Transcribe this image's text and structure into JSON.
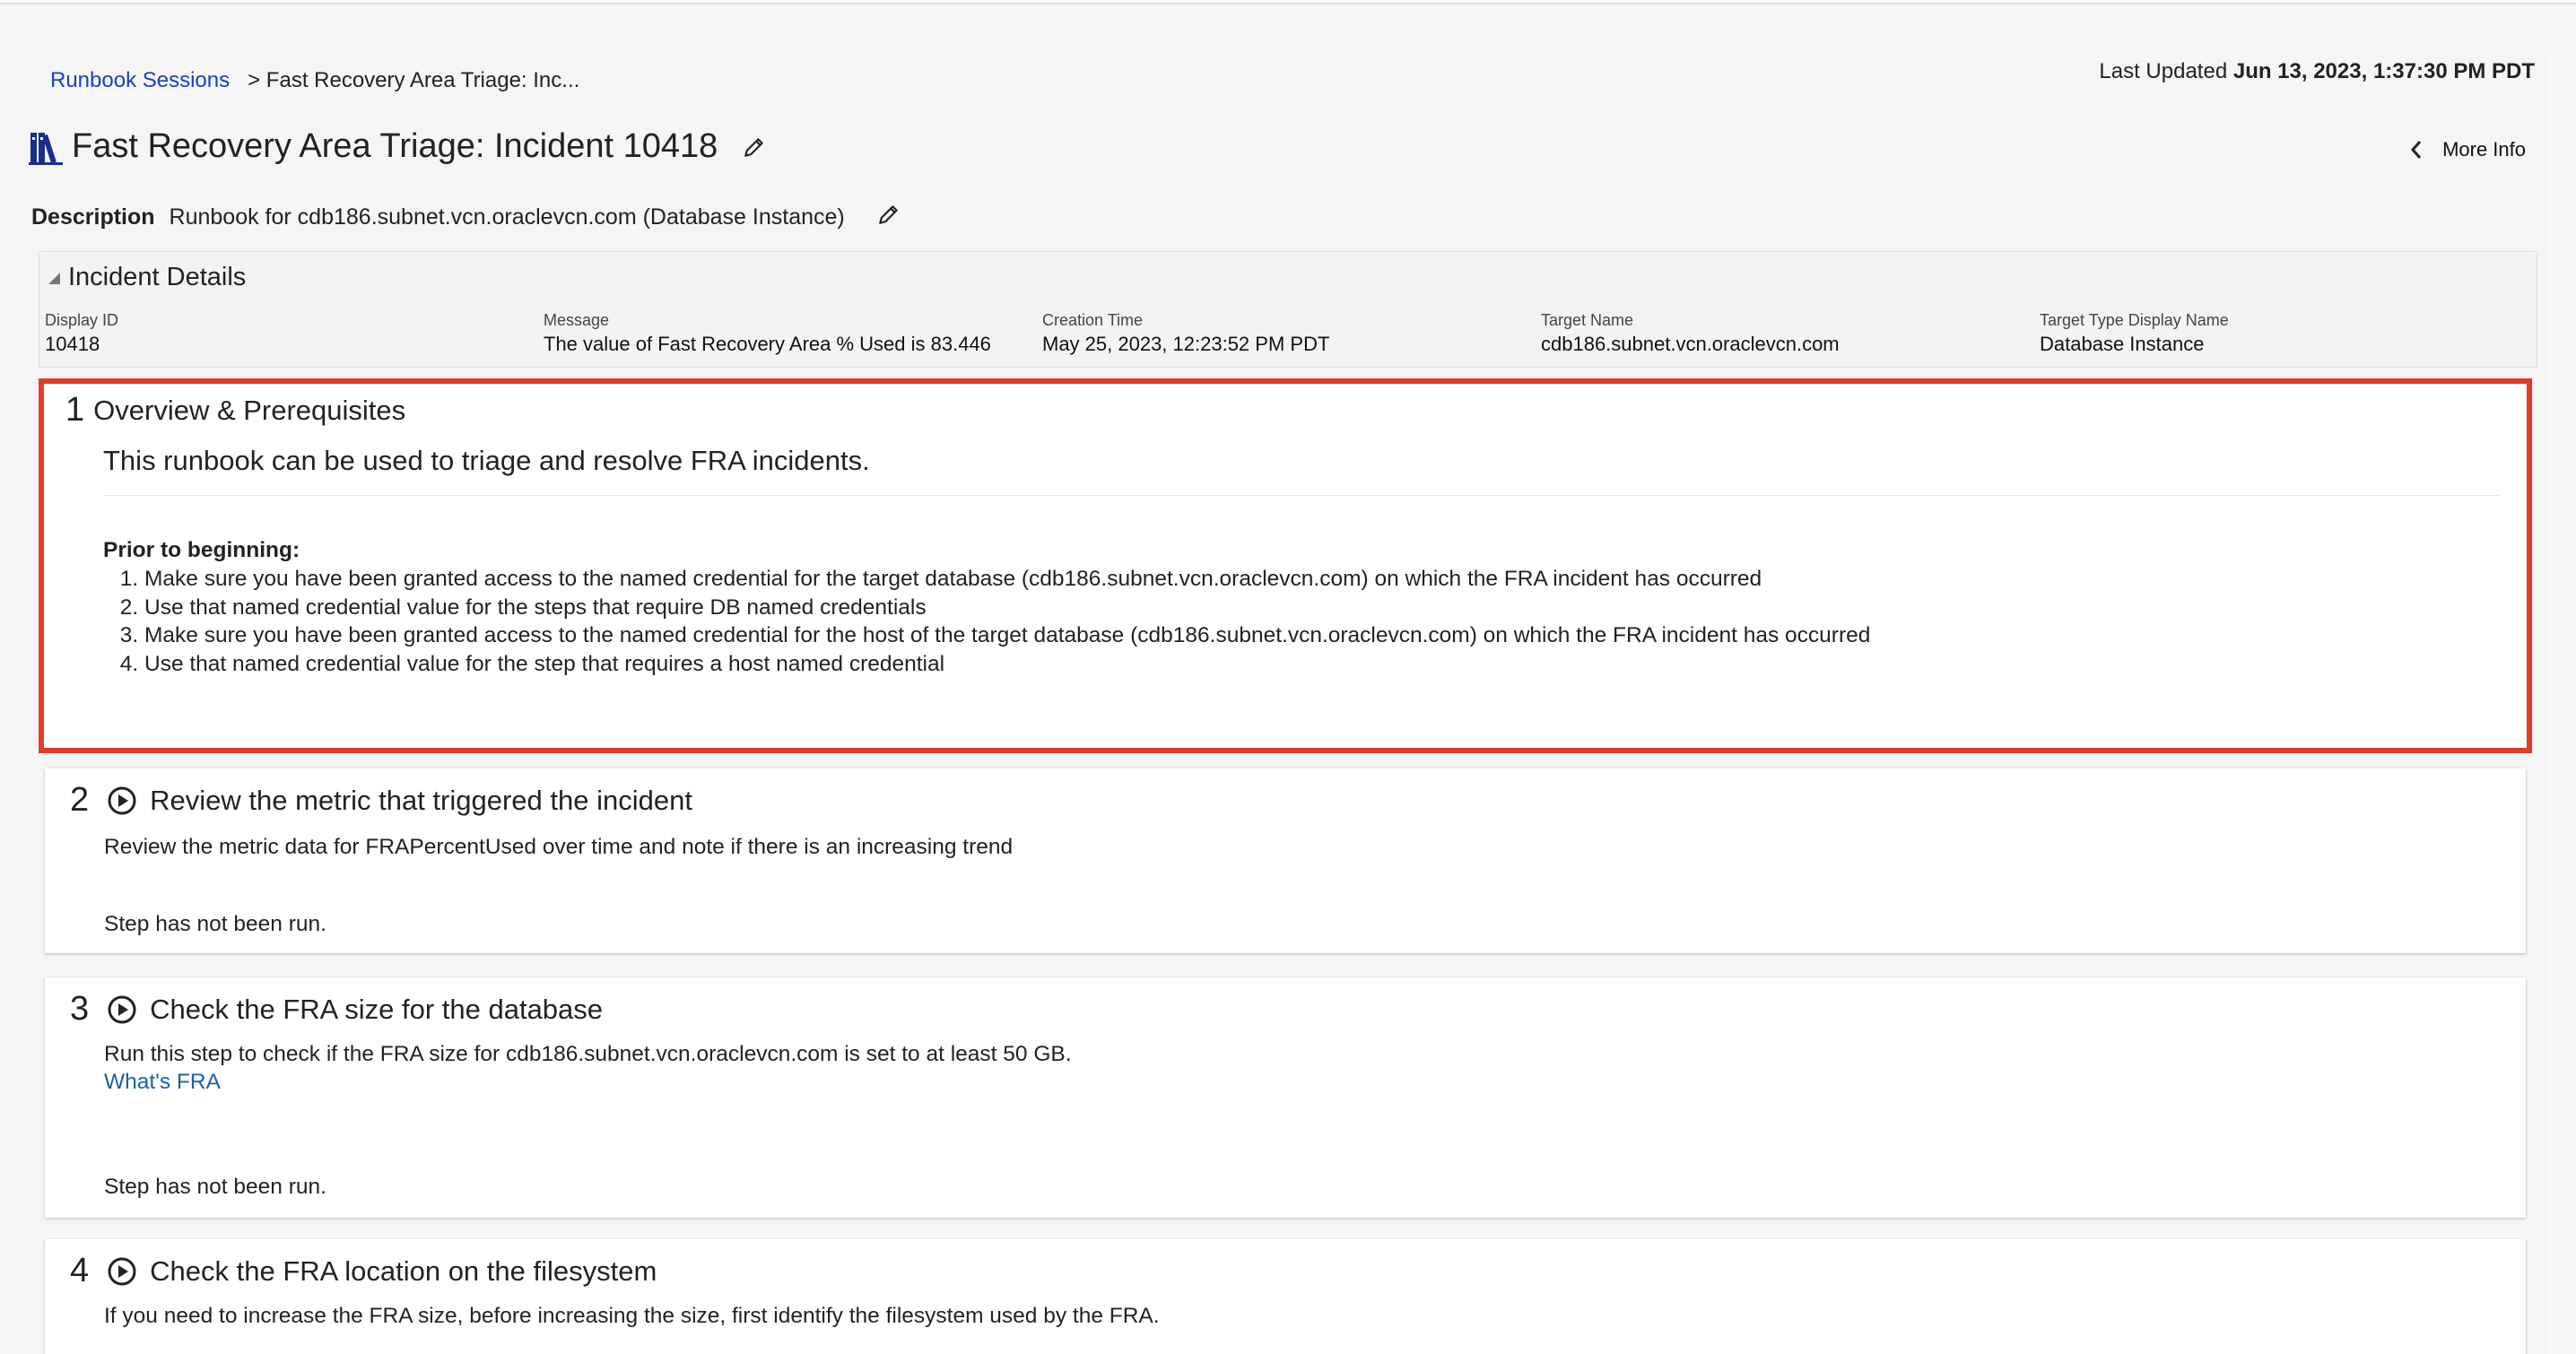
{
  "breadcrumb": {
    "root": "Runbook Sessions",
    "current": "> Fast Recovery Area Triage: Inc..."
  },
  "last_updated": {
    "label": "Last Updated",
    "value": "Jun 13, 2023, 1:37:30 PM PDT"
  },
  "page_title": "Fast Recovery Area Triage: Incident 10418",
  "more_info": "More Info",
  "description": {
    "label": "Description",
    "value": "Runbook for cdb186.subnet.vcn.oraclevcn.com (Database Instance)"
  },
  "incident": {
    "heading": "Incident Details",
    "fields": [
      {
        "label": "Display ID",
        "value": "10418"
      },
      {
        "label": "Message",
        "value": "The value of Fast Recovery Area % Used is 83.446"
      },
      {
        "label": "Creation Time",
        "value": "May 25, 2023, 12:23:52 PM PDT"
      },
      {
        "label": "Target Name",
        "value": "cdb186.subnet.vcn.oraclevcn.com"
      },
      {
        "label": "Target Type Display Name",
        "value": "Database Instance"
      }
    ]
  },
  "steps": [
    {
      "number": "1",
      "title": "Overview & Prerequisites",
      "lead": "This runbook can be used to triage and resolve FRA incidents.",
      "prior_label": "Prior to beginning:",
      "prior_items": [
        "Make sure you have been granted access to the named credential for the target database (cdb186.subnet.vcn.oraclevcn.com) on which the FRA incident has occurred",
        "Use that named credential value for the steps that require DB named credentials",
        "Make sure you have been granted access to the named credential for the host of the target database (cdb186.subnet.vcn.oraclevcn.com) on which the FRA incident has occurred",
        "Use that named credential value for the step that requires a host named credential"
      ]
    },
    {
      "number": "2",
      "title": "Review the metric that triggered the incident",
      "text": "Review the metric data for FRAPercentUsed over time and note if there is an increasing trend",
      "status": "Step has not been run."
    },
    {
      "number": "3",
      "title": "Check the FRA size for the database",
      "text": "Run this step to check if the FRA size for cdb186.subnet.vcn.oraclevcn.com is set to at least 50 GB.",
      "link": "What's FRA",
      "status": "Step has not been run."
    },
    {
      "number": "4",
      "title": "Check the FRA location on the filesystem",
      "text": "If you need to increase the FRA size, before increasing the size, first identify the filesystem used by the FRA."
    }
  ],
  "colors": {
    "link": "#1a40c2",
    "highlight_border": "#e23b29",
    "icon": "#1a2f8a"
  },
  "icons": [
    "book-stack-icon",
    "pencil-icon",
    "chevron-left-icon",
    "collapse-triangle-icon",
    "run-play-icon"
  ]
}
